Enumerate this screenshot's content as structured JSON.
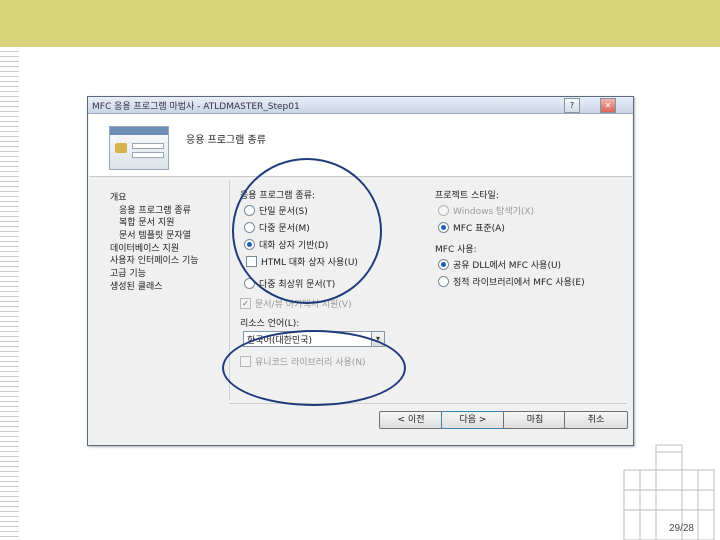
{
  "wizard": {
    "title": "MFC 응용 프로그램 마법사 - ATLDMASTER_Step01",
    "help_glyph": "?",
    "close_glyph": "✕",
    "header_title": "응용 프로그램 종류",
    "nav": [
      "개요",
      "응용 프로그램 종류",
      "복합 문서 지원",
      "문서 템플릿 문자열",
      "데이터베이스 지원",
      "사용자 인터페이스 기능",
      "고급 기능",
      "생성된 클래스"
    ],
    "app_type": {
      "label": "응용 프로그램 종류:",
      "options": {
        "single_doc": "단일 문서(S)",
        "multi_doc": "다중 문서(M)",
        "dialog_based": "대화 상자 기반(D)",
        "html_dialog": "HTML 대화 상자 사용(U)",
        "multi_top_level": "다중 최상위 문서(T)"
      },
      "selected": "dialog_based"
    },
    "doc_view": {
      "label": "문서/뷰 아키텍처 지원(V)",
      "checked": true,
      "enabled": false
    },
    "resource_lang": {
      "label": "리소스 언어(L):",
      "value": "한국어(대한민국)",
      "arrow": "▾"
    },
    "unicode": {
      "label": "유니코드 라이브러리 사용(N)",
      "checked": false,
      "enabled": false
    },
    "project_style": {
      "label": "프로젝트 스타일:",
      "options": {
        "windows_explorer": "Windows 탐색기(X)",
        "mfc_standard": "MFC 표준(A)"
      },
      "selected": "mfc_standard"
    },
    "mfc_use": {
      "label": "MFC 사용:",
      "options": {
        "shared_dll": "공유 DLL에서 MFC 사용(U)",
        "static_lib": "정적 라이브러리에서 MFC 사용(E)"
      },
      "selected": "shared_dll"
    },
    "buttons": {
      "prev": "< 이전",
      "next": "다음 >",
      "finish": "마침",
      "cancel": "취소"
    }
  },
  "slide_number": "29/28",
  "annotation_color": "#203b7a"
}
